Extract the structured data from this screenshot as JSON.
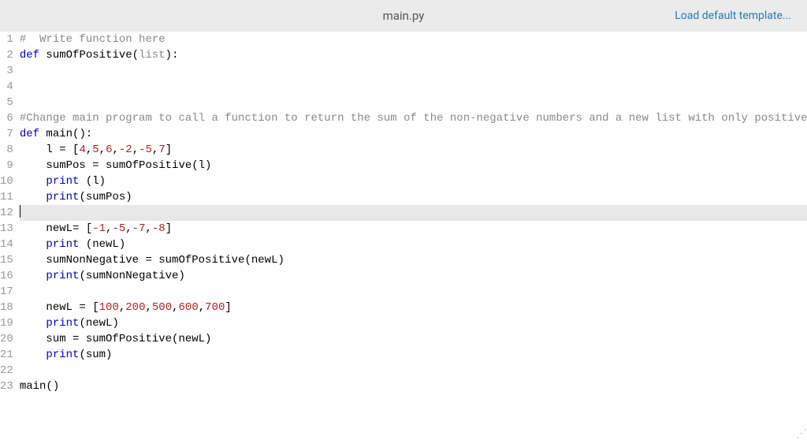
{
  "header": {
    "title": "main.py",
    "link": "Load default template..."
  },
  "editor": {
    "active_line": 12,
    "lines": [
      {
        "n": 1,
        "tokens": [
          {
            "t": "# ",
            "c": "comment"
          },
          {
            "t": " Write function here",
            "c": "comment"
          }
        ]
      },
      {
        "n": 2,
        "tokens": [
          {
            "t": "def",
            "c": "keyword"
          },
          {
            "t": " sumOfPositive("
          },
          {
            "t": "list",
            "c": "param"
          },
          {
            "t": "):"
          }
        ]
      },
      {
        "n": 3,
        "tokens": []
      },
      {
        "n": 4,
        "tokens": []
      },
      {
        "n": 5,
        "tokens": []
      },
      {
        "n": 6,
        "tokens": [
          {
            "t": "#Change main program to call a function to return the sum of the non-negative numbers and a new list with only positive numbe",
            "c": "comment"
          }
        ]
      },
      {
        "n": 7,
        "tokens": [
          {
            "t": "def",
            "c": "keyword"
          },
          {
            "t": " main():"
          }
        ]
      },
      {
        "n": 8,
        "tokens": [
          {
            "t": "    l = ["
          },
          {
            "t": "4",
            "c": "number"
          },
          {
            "t": ","
          },
          {
            "t": "5",
            "c": "number"
          },
          {
            "t": ","
          },
          {
            "t": "6",
            "c": "number"
          },
          {
            "t": ","
          },
          {
            "t": "-2",
            "c": "number"
          },
          {
            "t": ","
          },
          {
            "t": "-5",
            "c": "number"
          },
          {
            "t": ","
          },
          {
            "t": "7",
            "c": "number"
          },
          {
            "t": "]"
          }
        ]
      },
      {
        "n": 9,
        "tokens": [
          {
            "t": "    sumPos = sumOfPositive(l)"
          }
        ]
      },
      {
        "n": 10,
        "tokens": [
          {
            "t": "    "
          },
          {
            "t": "print",
            "c": "builtin"
          },
          {
            "t": " (l)"
          }
        ]
      },
      {
        "n": 11,
        "tokens": [
          {
            "t": "    "
          },
          {
            "t": "print",
            "c": "builtin"
          },
          {
            "t": "(sumPos)"
          }
        ]
      },
      {
        "n": 12,
        "tokens": []
      },
      {
        "n": 13,
        "tokens": [
          {
            "t": "    newL= ["
          },
          {
            "t": "-1",
            "c": "number"
          },
          {
            "t": ","
          },
          {
            "t": "-5",
            "c": "number"
          },
          {
            "t": ","
          },
          {
            "t": "-7",
            "c": "number"
          },
          {
            "t": ","
          },
          {
            "t": "-8",
            "c": "number"
          },
          {
            "t": "]"
          }
        ]
      },
      {
        "n": 14,
        "tokens": [
          {
            "t": "    "
          },
          {
            "t": "print",
            "c": "builtin"
          },
          {
            "t": " (newL)"
          }
        ]
      },
      {
        "n": 15,
        "tokens": [
          {
            "t": "    sumNonNegative = sumOfPositive(newL)"
          }
        ]
      },
      {
        "n": 16,
        "tokens": [
          {
            "t": "    "
          },
          {
            "t": "print",
            "c": "builtin"
          },
          {
            "t": "(sumNonNegative)"
          }
        ]
      },
      {
        "n": 17,
        "tokens": []
      },
      {
        "n": 18,
        "tokens": [
          {
            "t": "    newL = ["
          },
          {
            "t": "100",
            "c": "number"
          },
          {
            "t": ","
          },
          {
            "t": "200",
            "c": "number"
          },
          {
            "t": ","
          },
          {
            "t": "500",
            "c": "number"
          },
          {
            "t": ","
          },
          {
            "t": "600",
            "c": "number"
          },
          {
            "t": ","
          },
          {
            "t": "700",
            "c": "number"
          },
          {
            "t": "]"
          }
        ]
      },
      {
        "n": 19,
        "tokens": [
          {
            "t": "    "
          },
          {
            "t": "print",
            "c": "builtin"
          },
          {
            "t": "(newL)"
          }
        ]
      },
      {
        "n": 20,
        "tokens": [
          {
            "t": "    sum = sumOfPositive(newL)"
          }
        ]
      },
      {
        "n": 21,
        "tokens": [
          {
            "t": "    "
          },
          {
            "t": "print",
            "c": "builtin"
          },
          {
            "t": "(sum)"
          }
        ]
      },
      {
        "n": 22,
        "tokens": []
      },
      {
        "n": 23,
        "tokens": [
          {
            "t": "main()"
          }
        ]
      }
    ]
  }
}
